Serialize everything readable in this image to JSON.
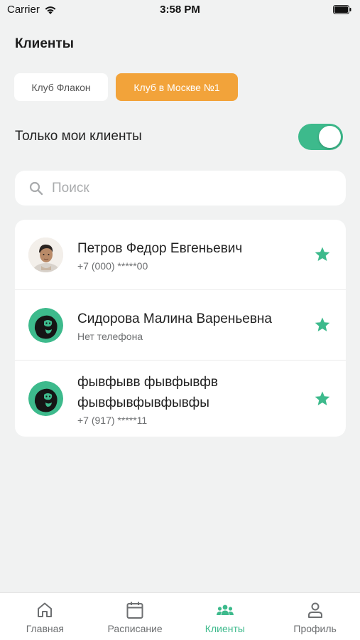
{
  "status_bar": {
    "carrier": "Carrier",
    "time": "3:58 PM"
  },
  "page": {
    "title": "Клиенты"
  },
  "clubs": [
    {
      "label": "Клуб Флакон",
      "active": false
    },
    {
      "label": "Клуб в Москве №1",
      "active": true
    }
  ],
  "filter": {
    "label": "Только мои клиенты",
    "enabled": true
  },
  "search": {
    "placeholder": "Поиск",
    "value": ""
  },
  "clients": [
    {
      "name": "Петров Федор Евгеньевич",
      "phone": "+7 (000) *****00",
      "avatar": "photo",
      "favorite": true
    },
    {
      "name": "Сидорова Малина Вареньевна",
      "phone": "Нет телефона",
      "avatar": "default-logo",
      "favorite": true
    },
    {
      "name": "фывфывв фывфывфв фывфывфывфывфы",
      "phone": "+7 (917) *****11",
      "avatar": "default-logo",
      "favorite": true
    }
  ],
  "tab_bar": {
    "items": [
      {
        "label": "Главная",
        "icon": "home-icon",
        "active": false
      },
      {
        "label": "Расписание",
        "icon": "calendar-icon",
        "active": false
      },
      {
        "label": "Клиенты",
        "icon": "clients-icon",
        "active": true
      },
      {
        "label": "Профиль",
        "icon": "profile-icon",
        "active": false
      }
    ]
  },
  "colors": {
    "accent_green": "#3dba8c",
    "accent_orange": "#f2a33a",
    "background": "#f1f2f2"
  }
}
